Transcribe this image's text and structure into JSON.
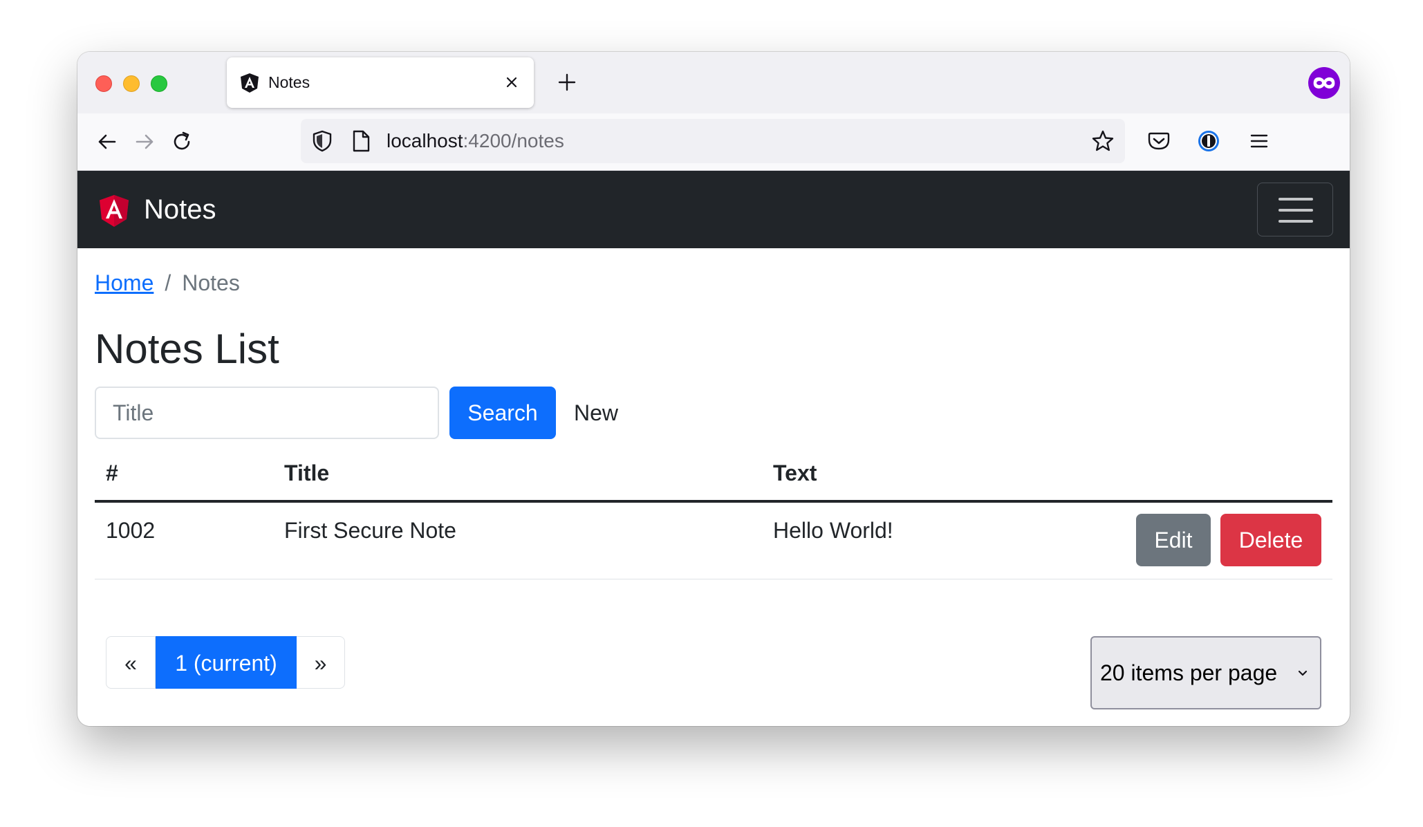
{
  "browser": {
    "tab_title": "Notes",
    "url_host": "localhost",
    "url_path": ":4200/notes"
  },
  "app": {
    "brand": "Notes",
    "breadcrumb": {
      "home": "Home",
      "separator": "/",
      "current": "Notes"
    },
    "title": "Notes List",
    "search": {
      "placeholder": "Title",
      "button_label": "Search",
      "new_label": "New"
    },
    "table": {
      "columns": [
        "#",
        "Title",
        "Text"
      ],
      "rows": [
        {
          "id": "1002",
          "title": "First Secure Note",
          "text": "Hello World!",
          "edit_label": "Edit",
          "delete_label": "Delete"
        }
      ]
    },
    "pagination": {
      "prev": "«",
      "current": "1 (current)",
      "next": "»"
    },
    "per_page": "20 items per page"
  },
  "colors": {
    "primary": "#0d6efd",
    "secondary": "#6c757d",
    "danger": "#dc3545",
    "navbar": "#212529"
  }
}
